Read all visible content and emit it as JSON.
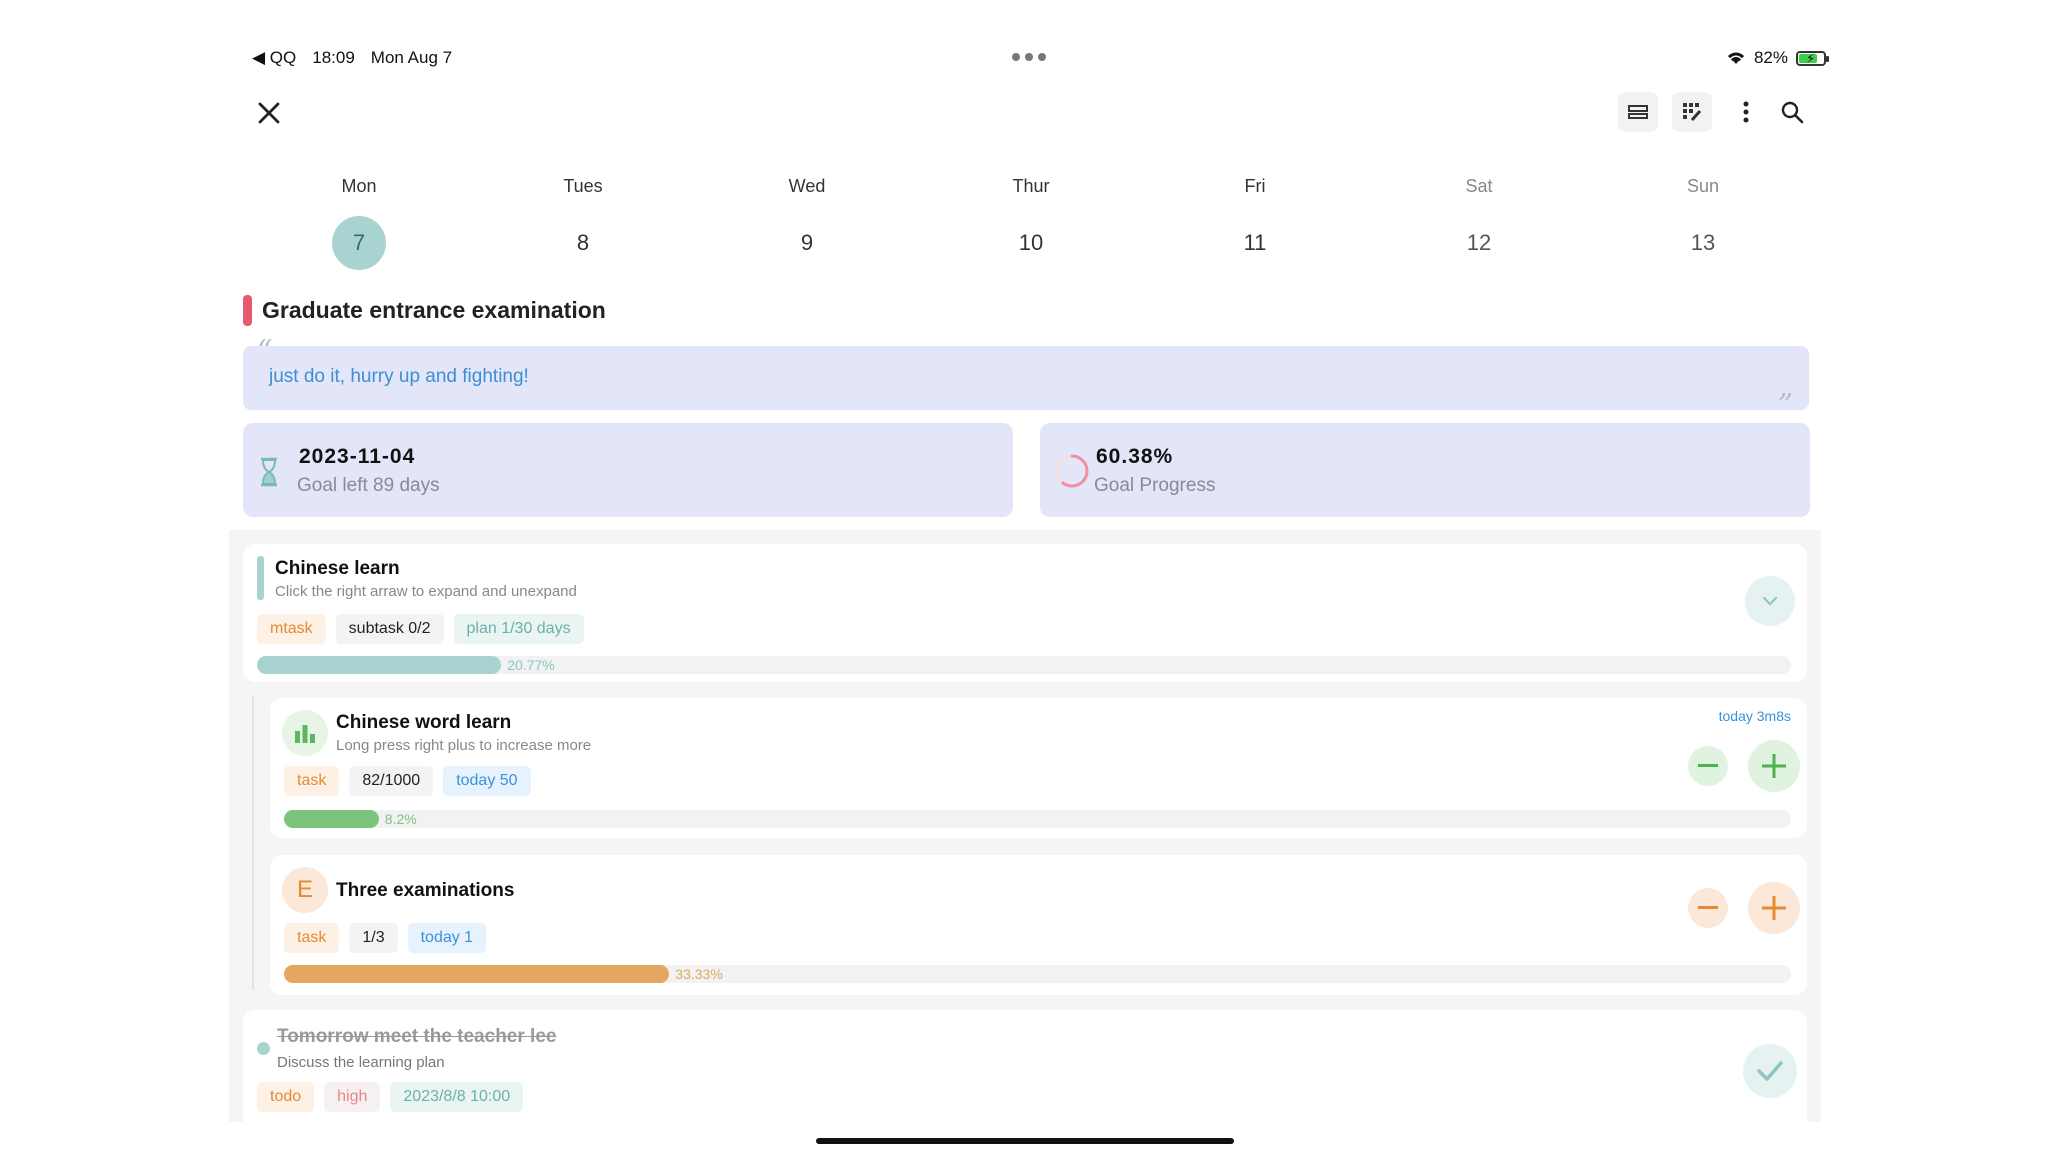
{
  "status_bar": {
    "back_app": "◀ QQ",
    "time": "18:09",
    "date": "Mon Aug 7",
    "battery": "82%",
    "battery_level": 0.82
  },
  "week": [
    {
      "name": "Mon",
      "num": "7",
      "active": true
    },
    {
      "name": "Tues",
      "num": "8"
    },
    {
      "name": "Wed",
      "num": "9"
    },
    {
      "name": "Thur",
      "num": "10"
    },
    {
      "name": "Fri",
      "num": "11"
    },
    {
      "name": "Sat",
      "num": "12"
    },
    {
      "name": "Sun",
      "num": "13"
    }
  ],
  "goal": {
    "title": "Graduate entrance examination",
    "quote": "just do it, hurry up and fighting!",
    "quote_open": "“",
    "quote_close": "”",
    "date": "2023-11-04",
    "days_left": "Goal left 89 days",
    "progress": "60.38%",
    "progress_value": 0.6038,
    "progress_label": "Goal Progress"
  },
  "mtask": {
    "title": "Chinese learn",
    "subtitle": "Click the right arraw to expand and unexpand",
    "tags": [
      "mtask",
      "subtask 0/2",
      "plan 1/30 days"
    ],
    "percent": "20.77%",
    "percent_value": 0.2077
  },
  "task1": {
    "title": "Chinese word learn",
    "subtitle": "Long press right plus to increase more",
    "time": "today 3m8s",
    "tags": [
      "task",
      "82/1000",
      "today 50"
    ],
    "percent": "8.2%",
    "percent_value": 0.082
  },
  "task2": {
    "title": "Three examinations",
    "avatar_letter": "E",
    "tags": [
      "task",
      "1/3",
      "today 1"
    ],
    "percent": "33.33%",
    "percent_value": 0.3333
  },
  "todo": {
    "title": "Tomorrow meet the teacher lee",
    "subtitle": "Discuss the learning plan",
    "tags": [
      "todo",
      "high",
      "2023/8/8 10:00"
    ]
  },
  "colors": {
    "teal": "#a9d3d1",
    "green": "#7cc47e",
    "orange": "#e4a661",
    "goal_red": "#e55a6f"
  }
}
